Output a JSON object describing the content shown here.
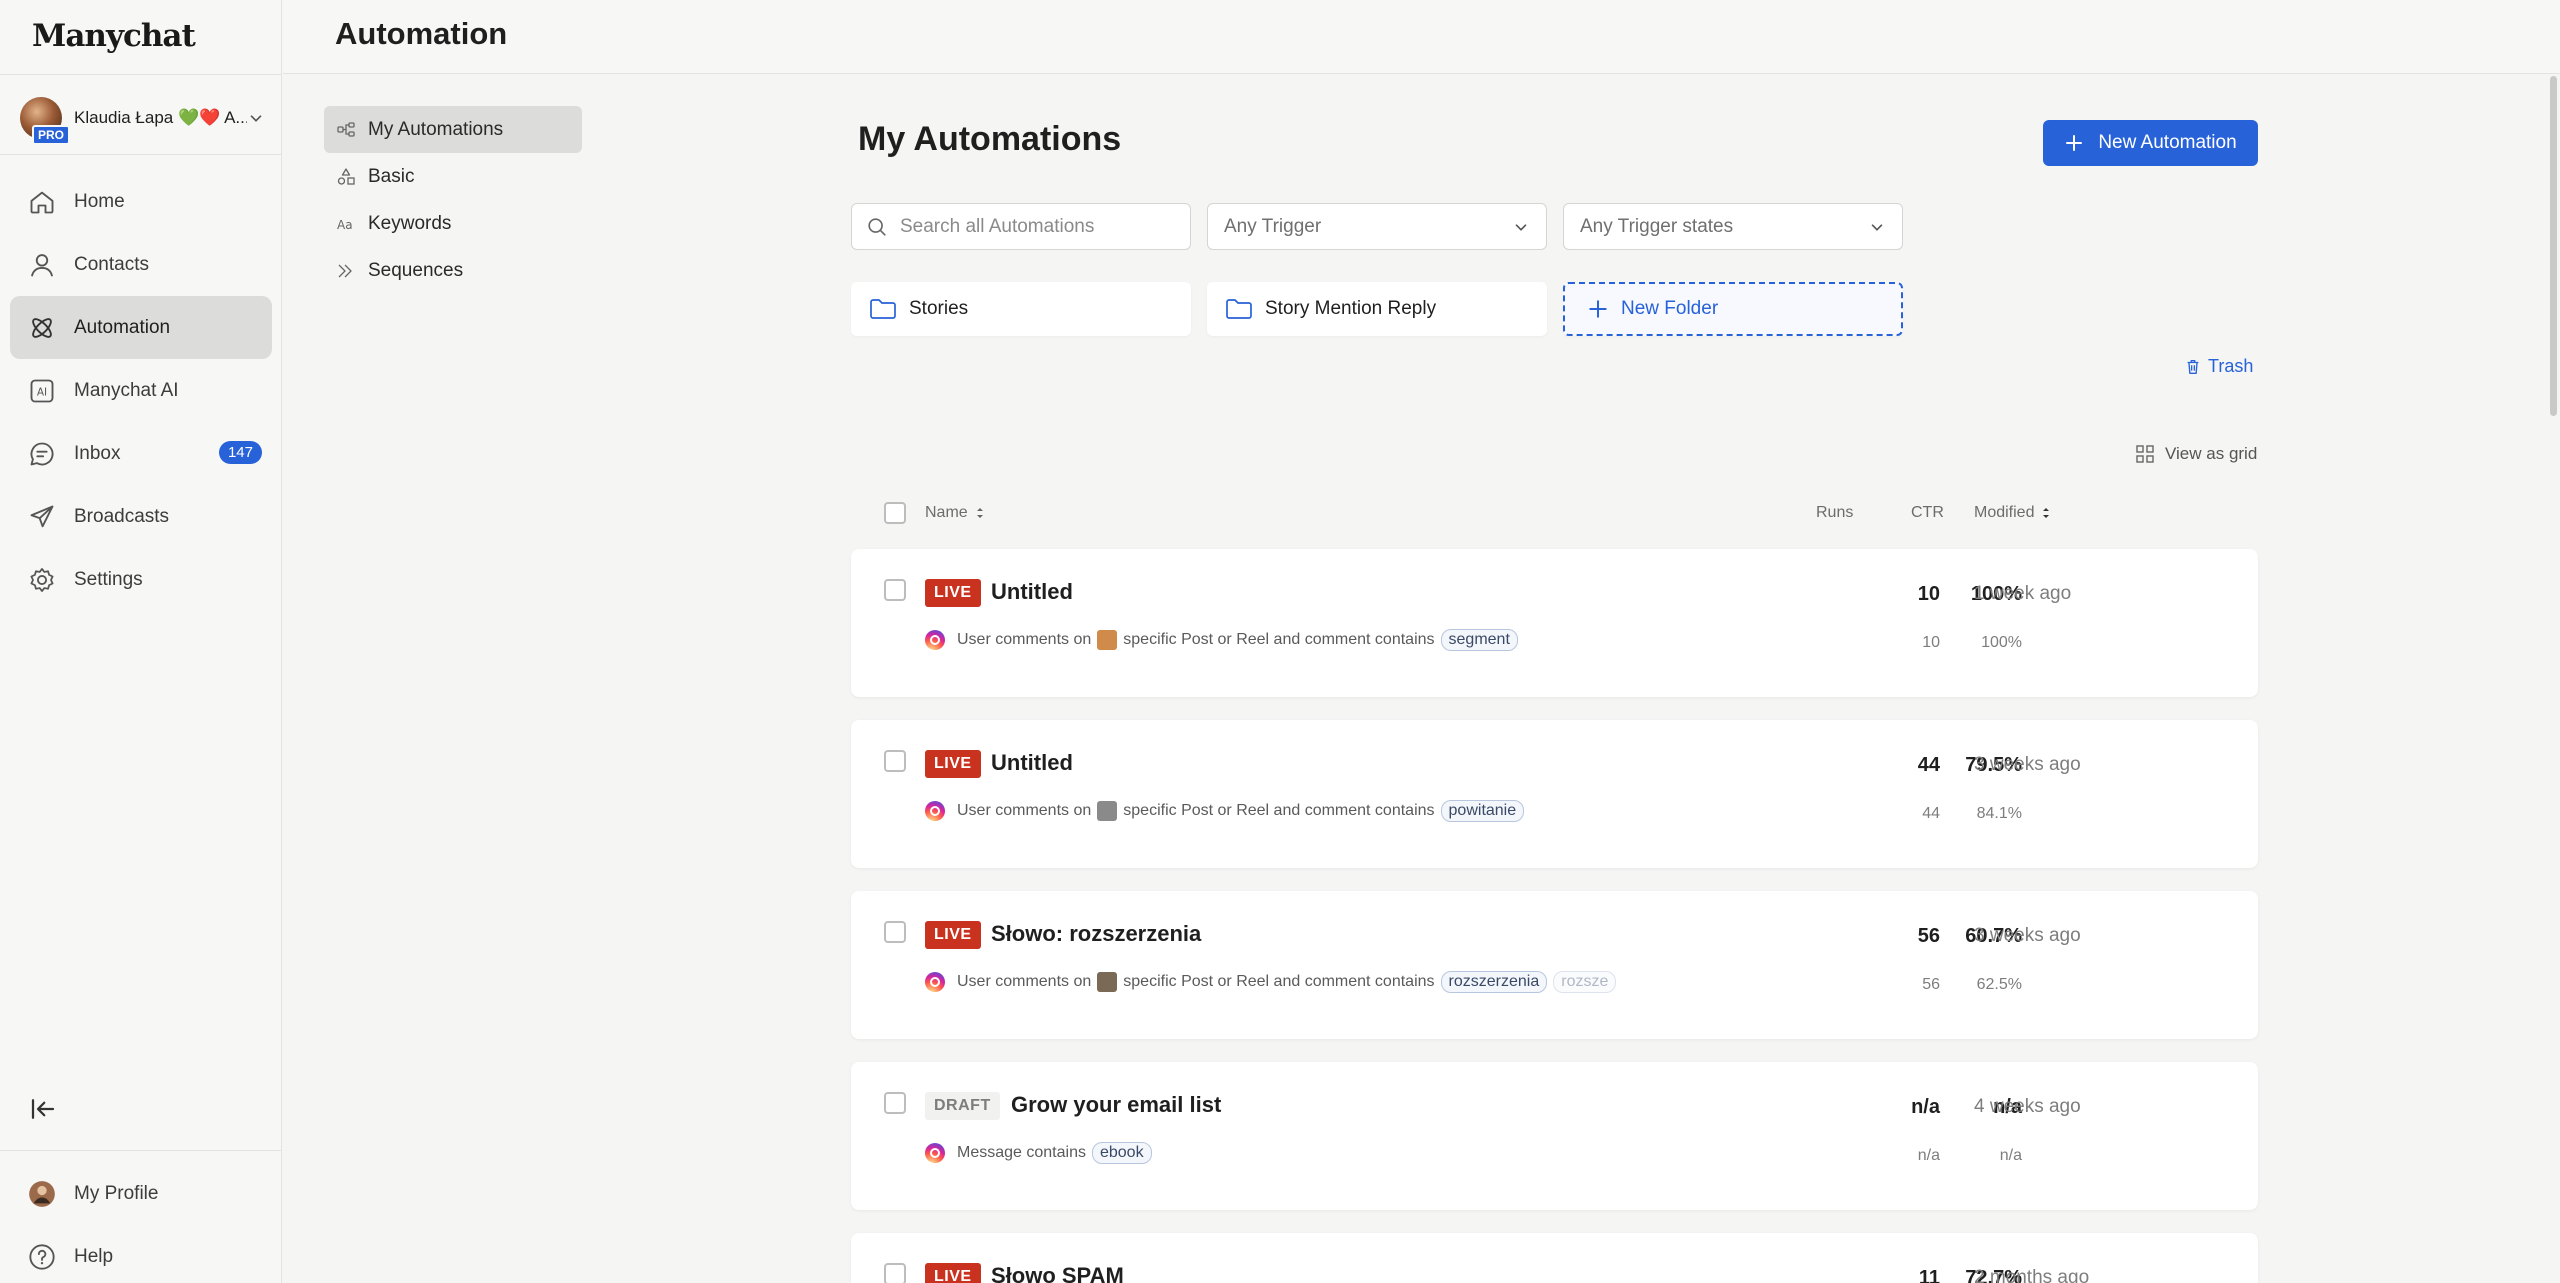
{
  "app": {
    "logo": "Manychat",
    "page_title": "Automation"
  },
  "account": {
    "name": "Klaudia Łapa 💚❤️ A...",
    "plan_badge": "PRO"
  },
  "nav": {
    "items": [
      {
        "label": "Home",
        "icon": "home-icon"
      },
      {
        "label": "Contacts",
        "icon": "user-icon"
      },
      {
        "label": "Automation",
        "icon": "automation-icon",
        "active": true
      },
      {
        "label": "Manychat AI",
        "icon": "ai-icon"
      },
      {
        "label": "Inbox",
        "icon": "chat-icon",
        "badge": "147"
      },
      {
        "label": "Broadcasts",
        "icon": "send-icon"
      },
      {
        "label": "Settings",
        "icon": "gear-icon"
      }
    ],
    "bottom": [
      {
        "label": "My Profile",
        "icon": "avatar"
      },
      {
        "label": "Help",
        "icon": "help-icon"
      }
    ]
  },
  "subnav": {
    "items": [
      {
        "label": "My Automations",
        "icon": "flow-icon",
        "active": true
      },
      {
        "label": "Basic",
        "icon": "shapes-icon"
      },
      {
        "label": "Keywords",
        "icon": "text-icon"
      },
      {
        "label": "Sequences",
        "icon": "sequence-icon"
      }
    ]
  },
  "main": {
    "title": "My Automations",
    "new_button": "New Automation",
    "search_placeholder": "Search all Automations",
    "trigger_filter": "Any Trigger",
    "state_filter": "Any Trigger states",
    "folders": [
      "Stories",
      "Story Mention Reply"
    ],
    "new_folder": "New Folder",
    "trash": "Trash",
    "view_toggle": "View as grid",
    "columns": {
      "name": "Name",
      "runs": "Runs",
      "ctr": "CTR",
      "modified": "Modified"
    }
  },
  "automations": [
    {
      "status": "LIVE",
      "title": "Untitled",
      "runs": "10",
      "ctr": "100%",
      "runs_sub": "10",
      "ctr_sub": "100%",
      "modified": "1 week ago",
      "desc_pre": "User comments on",
      "desc_post": "specific Post or Reel and comment contains",
      "keywords": [
        "segment"
      ],
      "thumb_color": "#d08a4a"
    },
    {
      "status": "LIVE",
      "title": "Untitled",
      "runs": "44",
      "ctr": "79.5%",
      "runs_sub": "44",
      "ctr_sub": "84.1%",
      "modified": "3 weeks ago",
      "desc_pre": "User comments on",
      "desc_post": "specific Post or Reel and comment contains",
      "keywords": [
        "powitanie"
      ],
      "thumb_color": "#8a8a8a"
    },
    {
      "status": "LIVE",
      "title": "Słowo: rozszerzenia",
      "runs": "56",
      "ctr": "60.7%",
      "runs_sub": "56",
      "ctr_sub": "62.5%",
      "modified": "3 weeks ago",
      "desc_pre": "User comments on",
      "desc_post": "specific Post or Reel and comment contains",
      "keywords": [
        "rozszerzenia",
        "rozsze"
      ],
      "thumb_color": "#7a6a55"
    },
    {
      "status": "DRAFT",
      "title": "Grow your email list",
      "runs": "n/a",
      "ctr": "n/a",
      "runs_sub": "n/a",
      "ctr_sub": "n/a",
      "modified": "4 weeks ago",
      "desc_pre": "Message contains",
      "desc_post": "",
      "keywords": [
        "ebook"
      ],
      "thumb_color": ""
    },
    {
      "status": "LIVE",
      "title": "Słowo SPAM",
      "runs": "11",
      "ctr": "72.7%",
      "modified": "2 months ago"
    }
  ]
}
